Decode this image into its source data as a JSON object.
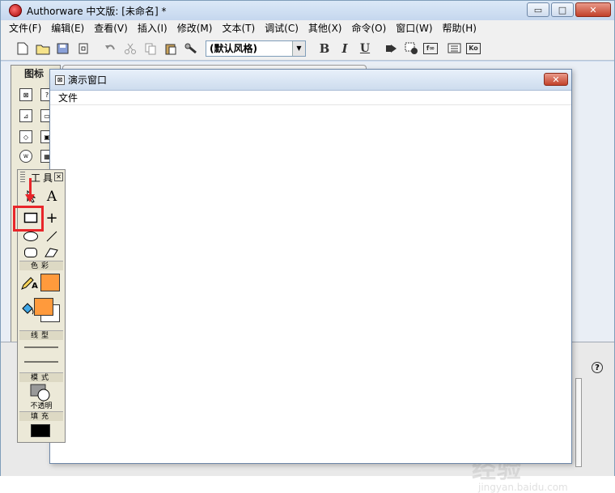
{
  "app": {
    "title": "Authorware 中文版: [未命名] *"
  },
  "window_buttons": {
    "minimize": "▭",
    "maximize": "□",
    "close": "✕"
  },
  "menu": [
    "文件(F)",
    "编辑(E)",
    "查看(V)",
    "插入(I)",
    "修改(M)",
    "文本(T)",
    "调试(C)",
    "其他(X)",
    "命令(O)",
    "窗口(W)",
    "帮助(H)"
  ],
  "toolbar": {
    "style_value": "(默认风格)",
    "bold": "B",
    "italic": "I",
    "underline": "U",
    "fn_label": "f∞",
    "ko_label": "Ko"
  },
  "icon_panel": {
    "title": "图标"
  },
  "demo_window": {
    "title": "演示窗口",
    "menu_file": "文件",
    "close": "✕"
  },
  "toolbox": {
    "title": "工具",
    "close": "✕",
    "text_tool": "A",
    "crosshair": "+",
    "color_label": "色彩",
    "line_label": "线型",
    "mode_label": "模式",
    "mode_value": "不透明",
    "fill_label": "填充",
    "pen_text": "A",
    "accent_color": "#ff9a3c"
  },
  "help_icon": "?",
  "watermark": {
    "main": "Baidu 经验",
    "sub": "jingyan.baidu.com"
  }
}
